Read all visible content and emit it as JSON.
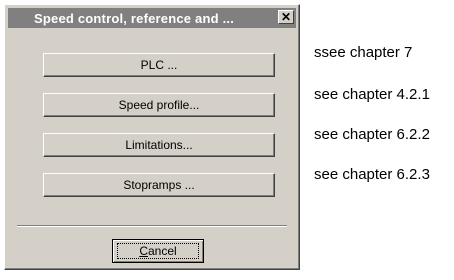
{
  "dialog": {
    "title": "Speed control, reference and ...",
    "close_glyph": "✕",
    "buttons": [
      {
        "label": "PLC ..."
      },
      {
        "label": "Speed profile..."
      },
      {
        "label": "Limitations..."
      },
      {
        "label": "Stopramps ..."
      }
    ],
    "cancel": {
      "accel": "C",
      "rest": "ancel"
    }
  },
  "references": [
    "ssee chapter 7",
    "see chapter 4.2.1",
    "see chapter 6.2.2",
    "see chapter 6.2.3"
  ],
  "colors": {
    "dialog_face": "#d4d0c8",
    "titlebar_inactive": "#808080",
    "title_text": "#ffffff"
  },
  "icons": {
    "close": "close-icon"
  }
}
